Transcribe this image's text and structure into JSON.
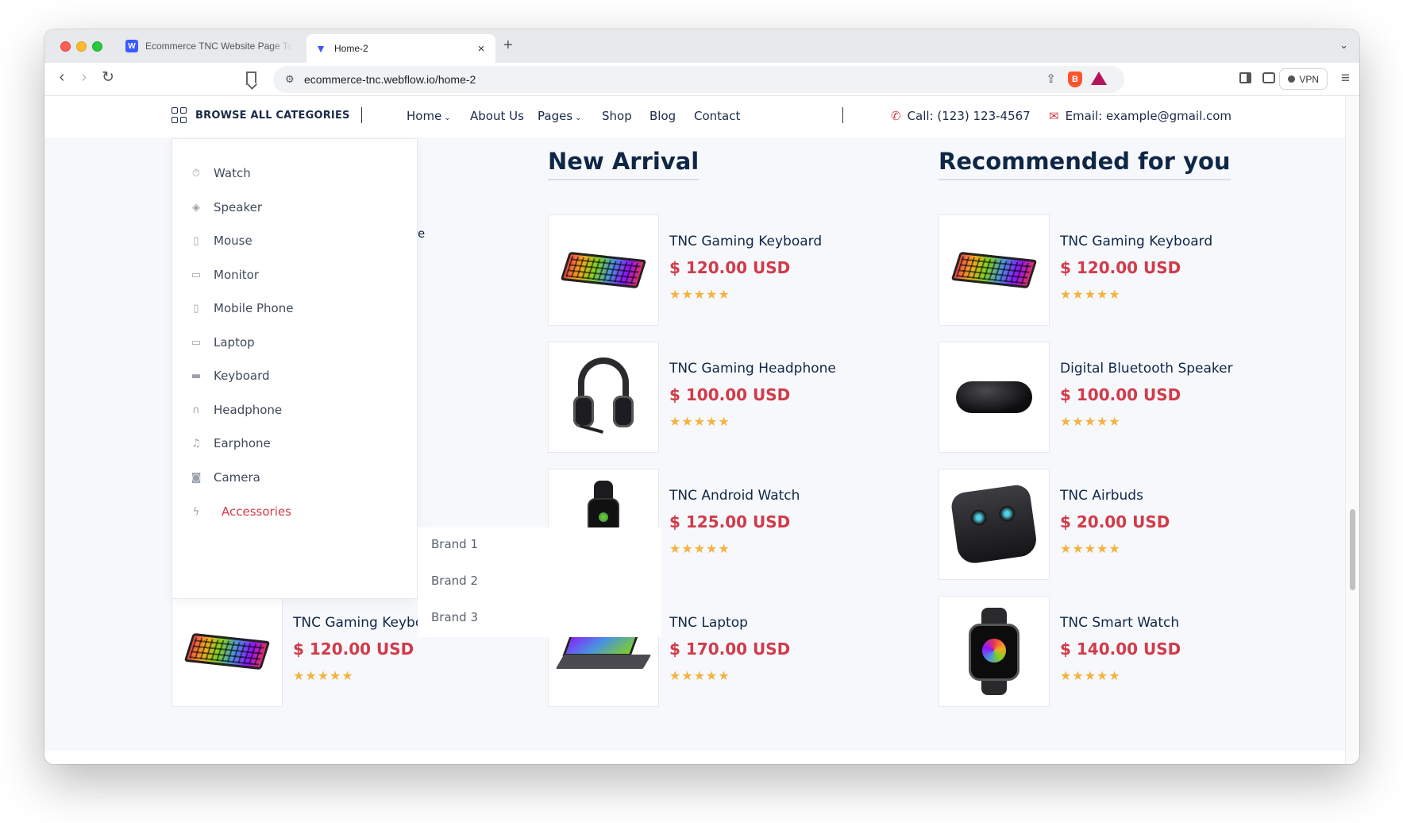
{
  "browser": {
    "tabs": [
      {
        "title": "Ecommerce TNC Website Page Te",
        "favicon": "webflow-icon",
        "active": false
      },
      {
        "title": "Home-2",
        "favicon": "tnc-logo-icon",
        "active": true
      }
    ],
    "url": "ecommerce-tnc.webflow.io/home-2",
    "vpn_label": "VPN"
  },
  "navbar": {
    "browse_label": "BROWSE ALL CATEGORIES",
    "links": [
      {
        "label": "Home",
        "has_dropdown": true
      },
      {
        "label": "About Us",
        "has_dropdown": false
      },
      {
        "label": "Pages",
        "has_dropdown": true
      },
      {
        "label": "Shop",
        "has_dropdown": false
      },
      {
        "label": "Blog",
        "has_dropdown": false
      },
      {
        "label": "Contact",
        "has_dropdown": false
      }
    ],
    "phone": "Call: (123) 123-4567",
    "email": "Email: example@gmail.com"
  },
  "categories": [
    {
      "label": "Watch",
      "icon": "watch-icon"
    },
    {
      "label": "Speaker",
      "icon": "speaker-icon"
    },
    {
      "label": "Mouse",
      "icon": "mouse-icon"
    },
    {
      "label": "Monitor",
      "icon": "monitor-icon"
    },
    {
      "label": "Mobile Phone",
      "icon": "mobile-phone-icon"
    },
    {
      "label": "Laptop",
      "icon": "laptop-icon"
    },
    {
      "label": "Keyboard",
      "icon": "keyboard-icon"
    },
    {
      "label": "Headphone",
      "icon": "headphone-icon"
    },
    {
      "label": "Earphone",
      "icon": "earphone-icon"
    },
    {
      "label": "Camera",
      "icon": "camera-icon"
    },
    {
      "label": "Accessories",
      "icon": "lightning-icon",
      "active": true
    }
  ],
  "brands": [
    "Brand 1",
    "Brand 2",
    "Brand 3"
  ],
  "peek_text": "e",
  "sections": {
    "new_arrival": {
      "title": "New Arrival",
      "products": [
        {
          "name": "TNC Gaming Keyboard",
          "price": "$ 120.00 USD",
          "stars": "★★★★★",
          "image": "keyboard"
        },
        {
          "name": "TNC Gaming Headphone",
          "price": "$ 100.00 USD",
          "stars": "★★★★★",
          "image": "headphone"
        },
        {
          "name": "TNC Android Watch",
          "price": "$ 125.00 USD",
          "stars": "★★★★★",
          "image": "watch"
        },
        {
          "name": "TNC Laptop",
          "price": "$ 170.00 USD",
          "stars": "★★★★★",
          "image": "laptop"
        }
      ]
    },
    "recommended": {
      "title": "Recommended for you",
      "products": [
        {
          "name": "TNC Gaming Keyboard",
          "price": "$ 120.00 USD",
          "stars": "★★★★★",
          "image": "keyboard"
        },
        {
          "name": "Digital Bluetooth Speaker",
          "price": "$ 100.00 USD",
          "stars": "★★★★★",
          "image": "speaker"
        },
        {
          "name": "TNC Airbuds",
          "price": "$ 20.00 USD",
          "stars": "★★★★★",
          "image": "airbuds"
        },
        {
          "name": "TNC Smart Watch",
          "price": "$ 140.00 USD",
          "stars": "★★★★★",
          "image": "smartwatch"
        }
      ]
    },
    "left_column": {
      "products": [
        {
          "name": "TNC Gaming Keybo",
          "price": "$ 120.00 USD",
          "stars": "★★★★★",
          "image": "keyboard"
        }
      ]
    }
  },
  "colors": {
    "accent": "#d13b49",
    "heading": "#0f2746",
    "star": "#f5b240"
  }
}
